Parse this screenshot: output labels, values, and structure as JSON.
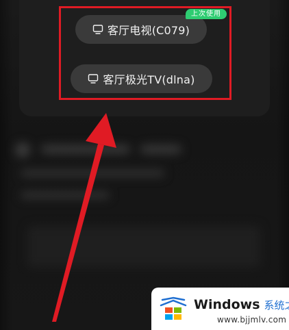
{
  "devices": [
    {
      "label": "客厅电视(C079)",
      "icon": "tv-icon"
    },
    {
      "label": "客厅极光TV(dlna)",
      "icon": "tv-icon"
    }
  ],
  "badge": {
    "label": "上次使用",
    "color": "#2ecc71"
  },
  "annotation": {
    "box_color": "#e01b24",
    "arrow_color": "#e01b24"
  },
  "watermark": {
    "brand": "Windows",
    "brand_cn": "系统之家",
    "url": "www.bjjmlv.com"
  }
}
